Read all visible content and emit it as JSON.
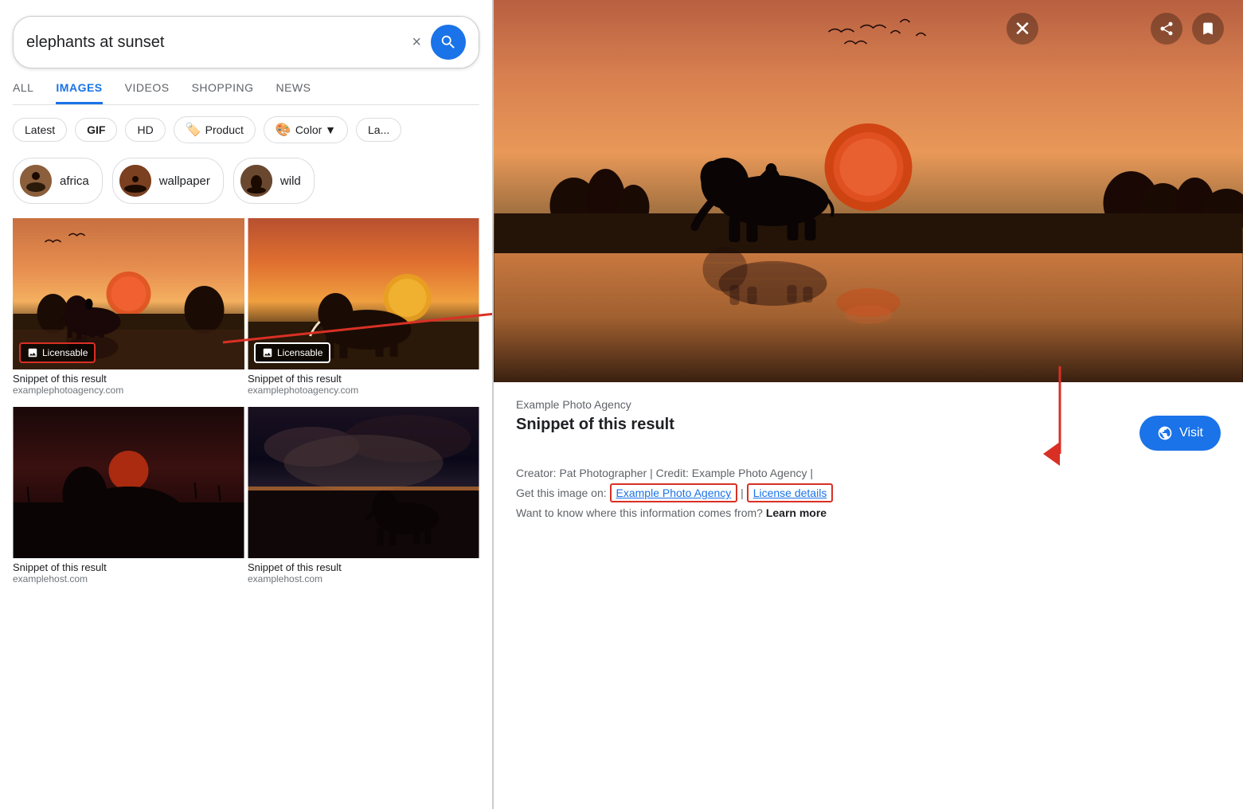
{
  "left": {
    "search": {
      "value": "elephants at sunset",
      "clear_label": "×",
      "search_btn_label": "Search"
    },
    "nav_tabs": [
      {
        "label": "ALL",
        "active": false
      },
      {
        "label": "IMAGES",
        "active": true
      },
      {
        "label": "VIDEOS",
        "active": false
      },
      {
        "label": "SHOPPING",
        "active": false
      },
      {
        "label": "NEWS",
        "active": false
      }
    ],
    "filters": [
      {
        "label": "Latest"
      },
      {
        "label": "GIF",
        "bold": true
      },
      {
        "label": "HD"
      },
      {
        "label": "Product",
        "icon": "🏷️"
      },
      {
        "label": "Color ▼",
        "icon": "🎨"
      },
      {
        "label": "La..."
      }
    ],
    "related_chips": [
      {
        "label": "africa"
      },
      {
        "label": "wallpaper"
      },
      {
        "label": "wild"
      }
    ],
    "grid_items": [
      {
        "caption": "Snippet of this result",
        "source": "examplephotoagency.com",
        "licensable": true,
        "scene": "1"
      },
      {
        "caption": "Snippet of this result",
        "source": "examplephotoagency.com",
        "licensable": true,
        "scene": "2"
      },
      {
        "caption": "Snippet of this result",
        "source": "examplehost.com",
        "licensable": false,
        "scene": "3"
      },
      {
        "caption": "Snippet of this result",
        "source": "examplehost.com",
        "licensable": false,
        "scene": "4"
      }
    ],
    "licensable_label": "Licensable"
  },
  "right": {
    "close_label": "×",
    "share_label": "⬆",
    "bookmark_label": "🔖",
    "agency": "Example Photo Agency",
    "title": "Snippet of this result",
    "visit_label": "Visit",
    "meta_line1": "Creator: Pat Photographer | Credit: Example Photo Agency |",
    "meta_line2_prefix": "Get this image on:",
    "meta_link1": "Example Photo Agency",
    "meta_separator": "|",
    "meta_link2": "License details",
    "meta_line3_prefix": "Want to know where this information comes from?",
    "meta_learn_more": "Learn more"
  }
}
